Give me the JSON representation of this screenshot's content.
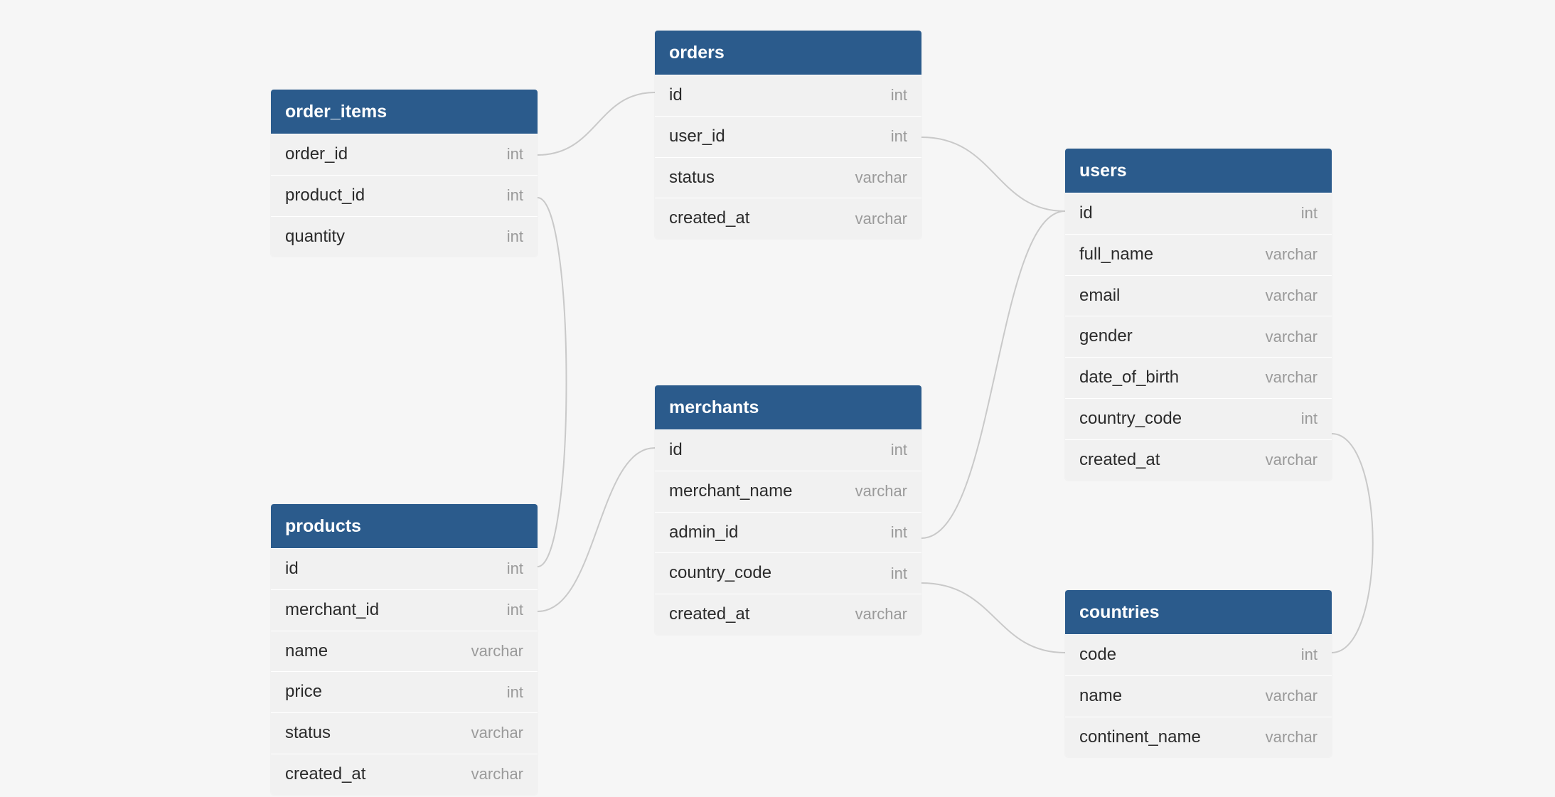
{
  "tables": {
    "order_items": {
      "title": "order_items",
      "columns": [
        {
          "name": "order_id",
          "type": "int"
        },
        {
          "name": "product_id",
          "type": "int"
        },
        {
          "name": "quantity",
          "type": "int"
        }
      ]
    },
    "orders": {
      "title": "orders",
      "columns": [
        {
          "name": "id",
          "type": "int"
        },
        {
          "name": "user_id",
          "type": "int"
        },
        {
          "name": "status",
          "type": "varchar"
        },
        {
          "name": "created_at",
          "type": "varchar"
        }
      ]
    },
    "merchants": {
      "title": "merchants",
      "columns": [
        {
          "name": "id",
          "type": "int"
        },
        {
          "name": "merchant_name",
          "type": "varchar"
        },
        {
          "name": "admin_id",
          "type": "int"
        },
        {
          "name": "country_code",
          "type": "int"
        },
        {
          "name": "created_at",
          "type": "varchar"
        }
      ]
    },
    "products": {
      "title": "products",
      "columns": [
        {
          "name": "id",
          "type": "int"
        },
        {
          "name": "merchant_id",
          "type": "int"
        },
        {
          "name": "name",
          "type": "varchar"
        },
        {
          "name": "price",
          "type": "int"
        },
        {
          "name": "status",
          "type": "varchar"
        },
        {
          "name": "created_at",
          "type": "varchar"
        }
      ]
    },
    "users": {
      "title": "users",
      "columns": [
        {
          "name": "id",
          "type": "int"
        },
        {
          "name": "full_name",
          "type": "varchar"
        },
        {
          "name": "email",
          "type": "varchar"
        },
        {
          "name": "gender",
          "type": "varchar"
        },
        {
          "name": "date_of_birth",
          "type": "varchar"
        },
        {
          "name": "country_code",
          "type": "int"
        },
        {
          "name": "created_at",
          "type": "varchar"
        }
      ]
    },
    "countries": {
      "title": "countries",
      "columns": [
        {
          "name": "code",
          "type": "int"
        },
        {
          "name": "name",
          "type": "varchar"
        },
        {
          "name": "continent_name",
          "type": "varchar"
        }
      ]
    }
  }
}
